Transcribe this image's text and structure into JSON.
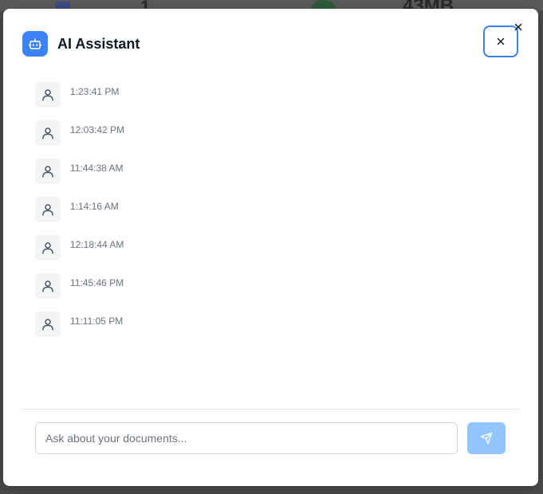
{
  "background": {
    "count_text": "1",
    "size_text": "43MB"
  },
  "header": {
    "title": "AI Assistant",
    "icon": "bot-icon",
    "close_icon": "close-icon"
  },
  "messages": [
    {
      "avatar_icon": "user-icon",
      "time": "1:23:41 PM"
    },
    {
      "avatar_icon": "user-icon",
      "time": "12:03:42 PM"
    },
    {
      "avatar_icon": "user-icon",
      "time": "11:44:38 AM"
    },
    {
      "avatar_icon": "user-icon",
      "time": "1:14:16 AM"
    },
    {
      "avatar_icon": "user-icon",
      "time": "12:18:44 AM"
    },
    {
      "avatar_icon": "user-icon",
      "time": "11:45:46 PM"
    },
    {
      "avatar_icon": "user-icon",
      "time": "11:11:05 PM"
    }
  ],
  "composer": {
    "placeholder": "Ask about your documents...",
    "value": "",
    "send_icon": "send-icon"
  },
  "colors": {
    "accent": "#3b82f6",
    "send_disabled": "#93c5fd"
  }
}
